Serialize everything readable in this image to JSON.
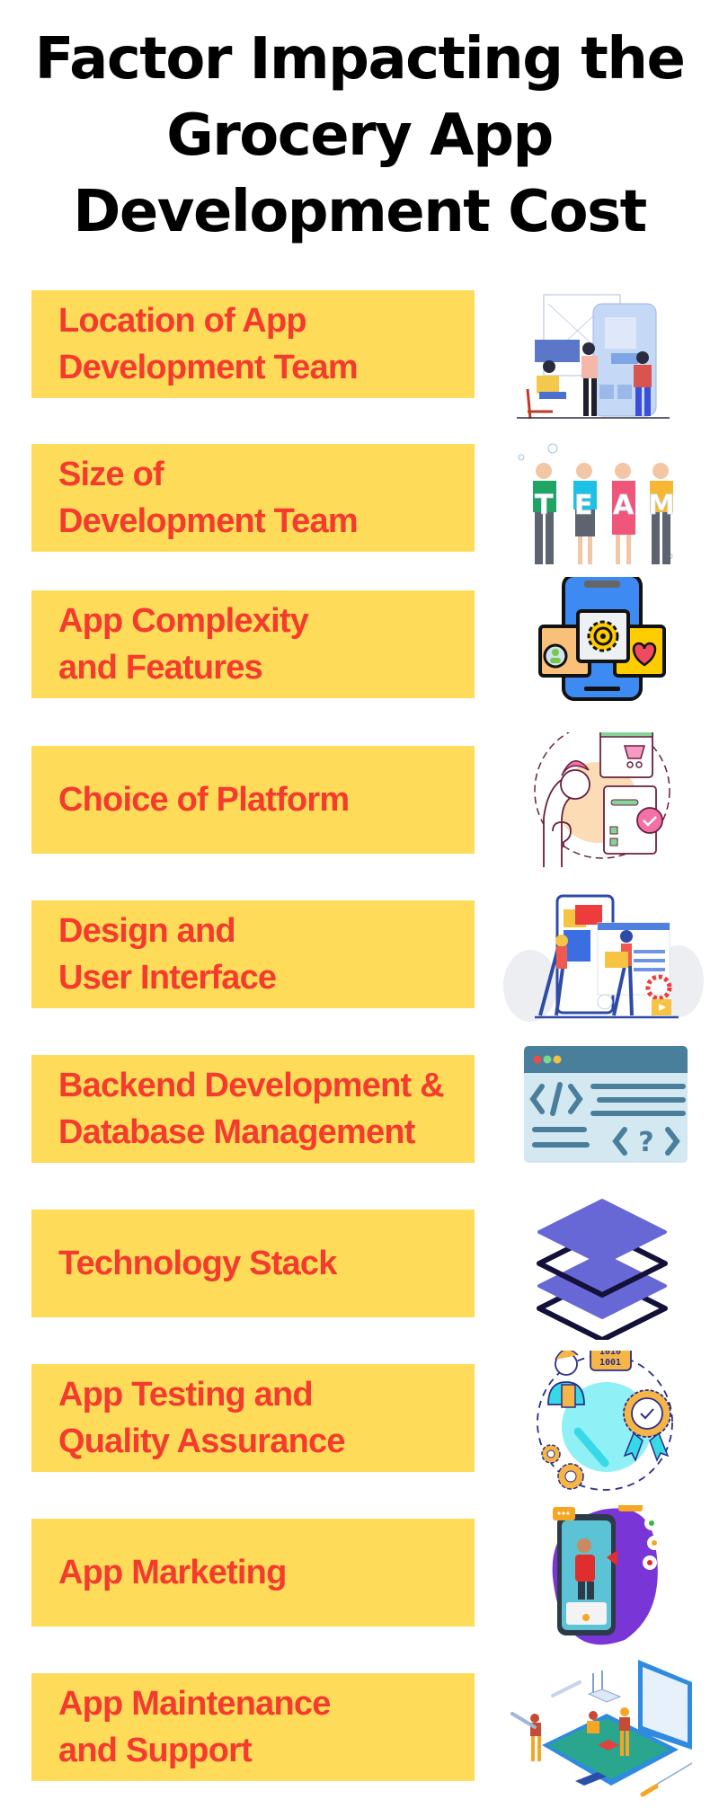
{
  "title": {
    "lines": [
      "Factor Impacting the",
      "Grocery App",
      "Development Cost"
    ]
  },
  "colors": {
    "banner_bg": "#FEDC5A",
    "banner_text": "#F53A2E",
    "title_text": "#000000"
  },
  "factors": [
    {
      "lines": [
        "Location of App",
        "Development Team"
      ],
      "icon": "team-collaboration-illustration"
    },
    {
      "lines": [
        "Size of",
        "Development Team"
      ],
      "icon": "team-people-illustration",
      "icon_text": [
        "T",
        "E",
        "A",
        "M"
      ]
    },
    {
      "lines": [
        "App Complexity",
        "and Features"
      ],
      "icon": "phone-features-gear-icon"
    },
    {
      "lines": [
        "Choice of Platform"
      ],
      "icon": "platform-choice-icon"
    },
    {
      "lines": [
        "Design and",
        "User Interface"
      ],
      "icon": "ui-design-illustration"
    },
    {
      "lines": [
        "Backend Development &",
        "Database Management"
      ],
      "icon": "code-window-icon"
    },
    {
      "lines": [
        "Technology Stack"
      ],
      "icon": "layers-stack-icon"
    },
    {
      "lines": [
        "App Testing and",
        "Quality Assurance"
      ],
      "icon": "quality-assurance-icon",
      "icon_text": [
        "1010",
        "1001"
      ]
    },
    {
      "lines": [
        "App Marketing"
      ],
      "icon": "app-marketing-illustration"
    },
    {
      "lines": [
        "App Maintenance",
        "and Support"
      ],
      "icon": "maintenance-support-illustration"
    }
  ]
}
